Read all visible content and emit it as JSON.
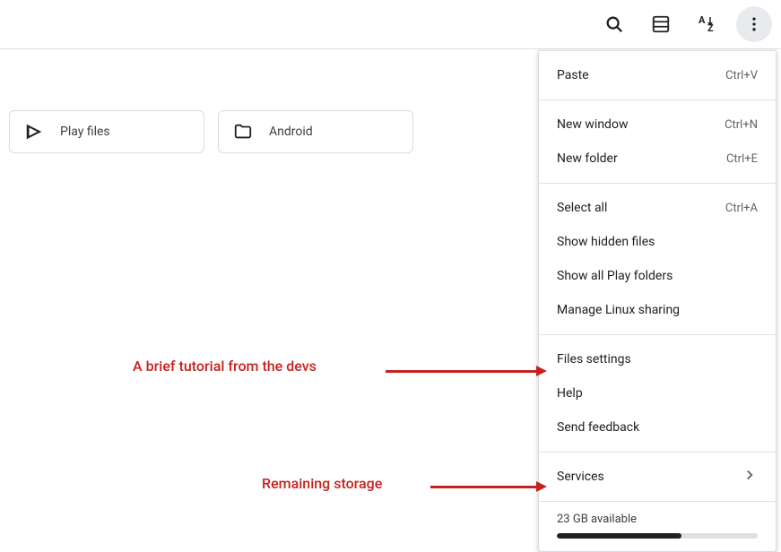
{
  "folders": [
    {
      "label": "Play files",
      "icon": "play"
    },
    {
      "label": "Android",
      "icon": "folder"
    }
  ],
  "menu": {
    "sections": [
      [
        {
          "label": "Paste",
          "shortcut": "Ctrl+V"
        }
      ],
      [
        {
          "label": "New window",
          "shortcut": "Ctrl+N"
        },
        {
          "label": "New folder",
          "shortcut": "Ctrl+E"
        }
      ],
      [
        {
          "label": "Select all",
          "shortcut": "Ctrl+A"
        },
        {
          "label": "Show hidden files"
        },
        {
          "label": "Show all Play folders"
        },
        {
          "label": "Manage Linux sharing"
        }
      ],
      [
        {
          "label": "Files settings"
        },
        {
          "label": "Help"
        },
        {
          "label": "Send feedback"
        }
      ],
      [
        {
          "label": "Services",
          "chevron": true
        }
      ]
    ],
    "storage": {
      "text": "23 GB available",
      "percent_used": 62
    }
  },
  "annotations": {
    "tutorial": "A brief tutorial from the devs",
    "storage": "Remaining storage"
  }
}
